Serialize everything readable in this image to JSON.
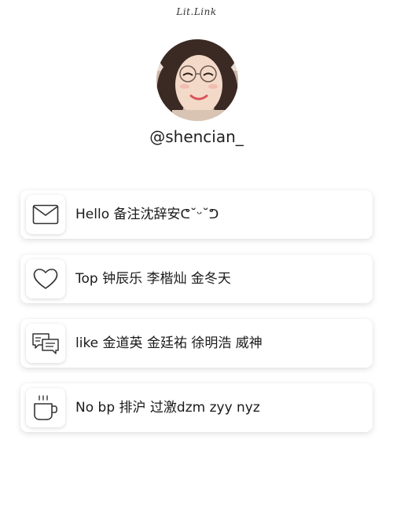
{
  "brand": "Lit.Link",
  "profile": {
    "username": "@shencian_"
  },
  "links": [
    {
      "icon": "envelope-icon",
      "label": "Hello 备注沈辞安ᕦ˘ᵕ˘ᕤ"
    },
    {
      "icon": "heart-icon",
      "label": "Top 钟辰乐 李楷灿 金冬天"
    },
    {
      "icon": "chat-bubbles-icon",
      "label": "like 金道英 金廷祐 徐明浩 威神"
    },
    {
      "icon": "coffee-cup-icon",
      "label": "No bp 排沪 过激dzm zyy nyz"
    }
  ]
}
